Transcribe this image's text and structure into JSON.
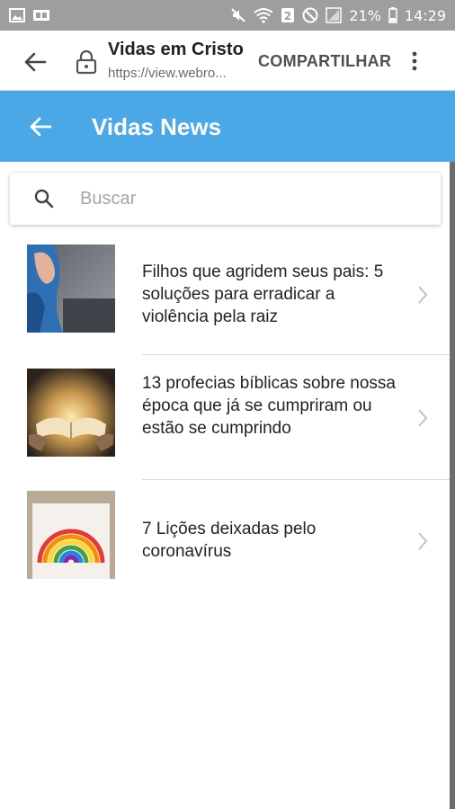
{
  "status_bar": {
    "battery": "21%",
    "time": "14:29",
    "notification_badge": "2"
  },
  "browser_bar": {
    "title": "Vidas em Cristo",
    "url": "https://view.webro...",
    "share_label": "COMPARTILHAR"
  },
  "header": {
    "title": "Vidas News"
  },
  "search": {
    "placeholder": "Buscar",
    "value": ""
  },
  "news": [
    {
      "title": "Filhos que agridem seus pais: 5 soluções para erradicar a violência pela raiz",
      "thumbnail": "child-arm-photo"
    },
    {
      "title": "13 profecias bíblicas sobre nossa época que já se cumpriram ou estão se cumprindo",
      "thumbnail": "glowing-bible-photo"
    },
    {
      "title": "7 Lições deixadas pelo coronavírus",
      "thumbnail": "rainbow-drawing-photo"
    }
  ],
  "colors": {
    "status_bar": "#9e9e9e",
    "header": "#4aa8e6",
    "divider": "#dcdcdc"
  }
}
